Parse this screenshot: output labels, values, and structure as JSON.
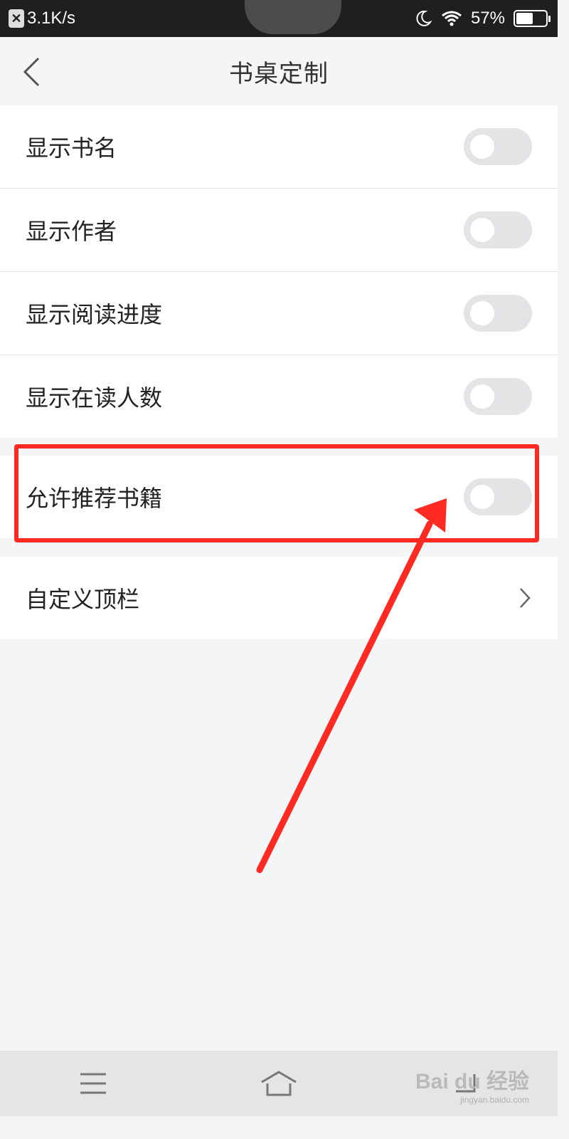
{
  "status_bar": {
    "net_speed": "3.1K/s",
    "battery_percent": "57%",
    "battery_level": 0.57
  },
  "header": {
    "title": "书桌定制"
  },
  "settings": [
    {
      "label": "显示书名",
      "enabled": false
    },
    {
      "label": "显示作者",
      "enabled": false
    },
    {
      "label": "显示阅读进度",
      "enabled": false
    },
    {
      "label": "显示在读人数",
      "enabled": false
    },
    {
      "label": "允许推荐书籍",
      "enabled": false
    }
  ],
  "custom_topbar": {
    "label": "自定义顶栏"
  },
  "annotation": {
    "color": "#ff2a22"
  },
  "watermark": {
    "text": "Bai du 经验",
    "sub": "jingyan.baidu.com"
  }
}
